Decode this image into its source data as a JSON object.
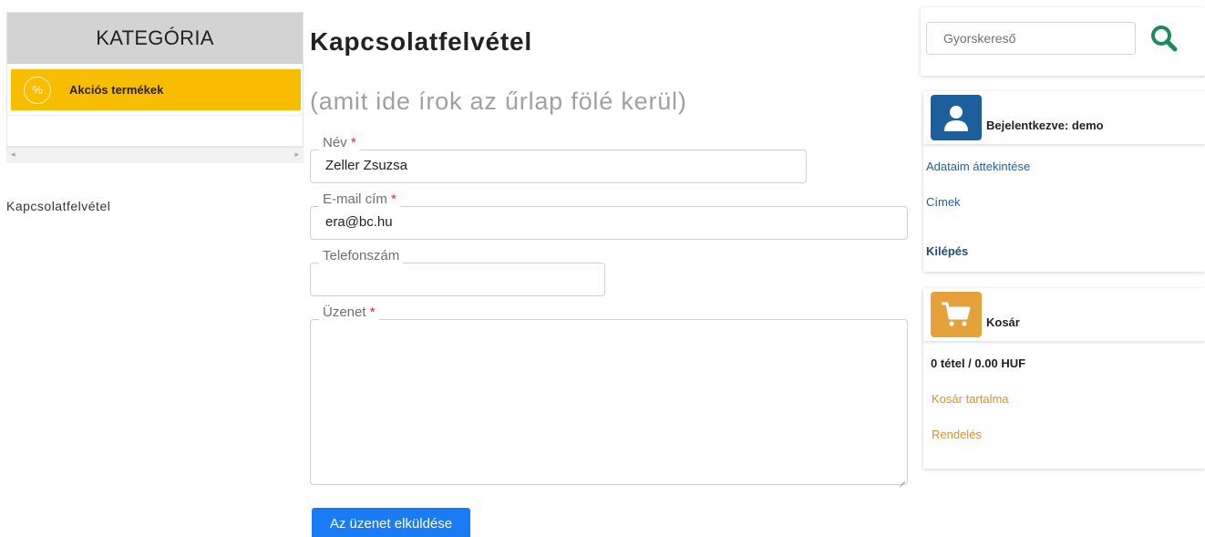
{
  "sidebar": {
    "category_title": "KATEGÓRIA",
    "items": [
      {
        "icon": "percent-icon",
        "icon_text": "%",
        "label": "Akciós termékek",
        "color": "#f9bd00"
      }
    ],
    "scroll_left": "◂",
    "scroll_right": "▸",
    "breadcrumb": "Kapcsolatfelvétel"
  },
  "main": {
    "title": "Kapcsolatfelvétel",
    "subtitle": "(amit ide írok az űrlap fölé kerül)",
    "form": {
      "name": {
        "label": "Név",
        "required_mark": "*",
        "value": "Zeller Zsuzsa"
      },
      "email": {
        "label": "E-mail cím",
        "required_mark": "*",
        "value": "era@bc.hu"
      },
      "phone": {
        "label": "Telefonszám",
        "value": ""
      },
      "message": {
        "label": "Üzenet",
        "required_mark": "*",
        "value": ""
      },
      "submit_label": "Az üzenet elküldése",
      "submit_color": "#1a7cf4"
    }
  },
  "right": {
    "search": {
      "placeholder": "Gyorskereső",
      "icon": "search-icon",
      "icon_color": "#1e8a5a"
    },
    "user": {
      "icon": "user-icon",
      "title": "Bejelentkezve: demo",
      "links": [
        "Adataim áttekintése",
        "Címek"
      ],
      "logout": "Kilépés"
    },
    "cart": {
      "icon": "cart-icon",
      "title": "Kosár",
      "summary": "0 tétel / 0.00 HUF",
      "links": [
        "Kosár tartalma",
        "Rendelés"
      ]
    }
  }
}
